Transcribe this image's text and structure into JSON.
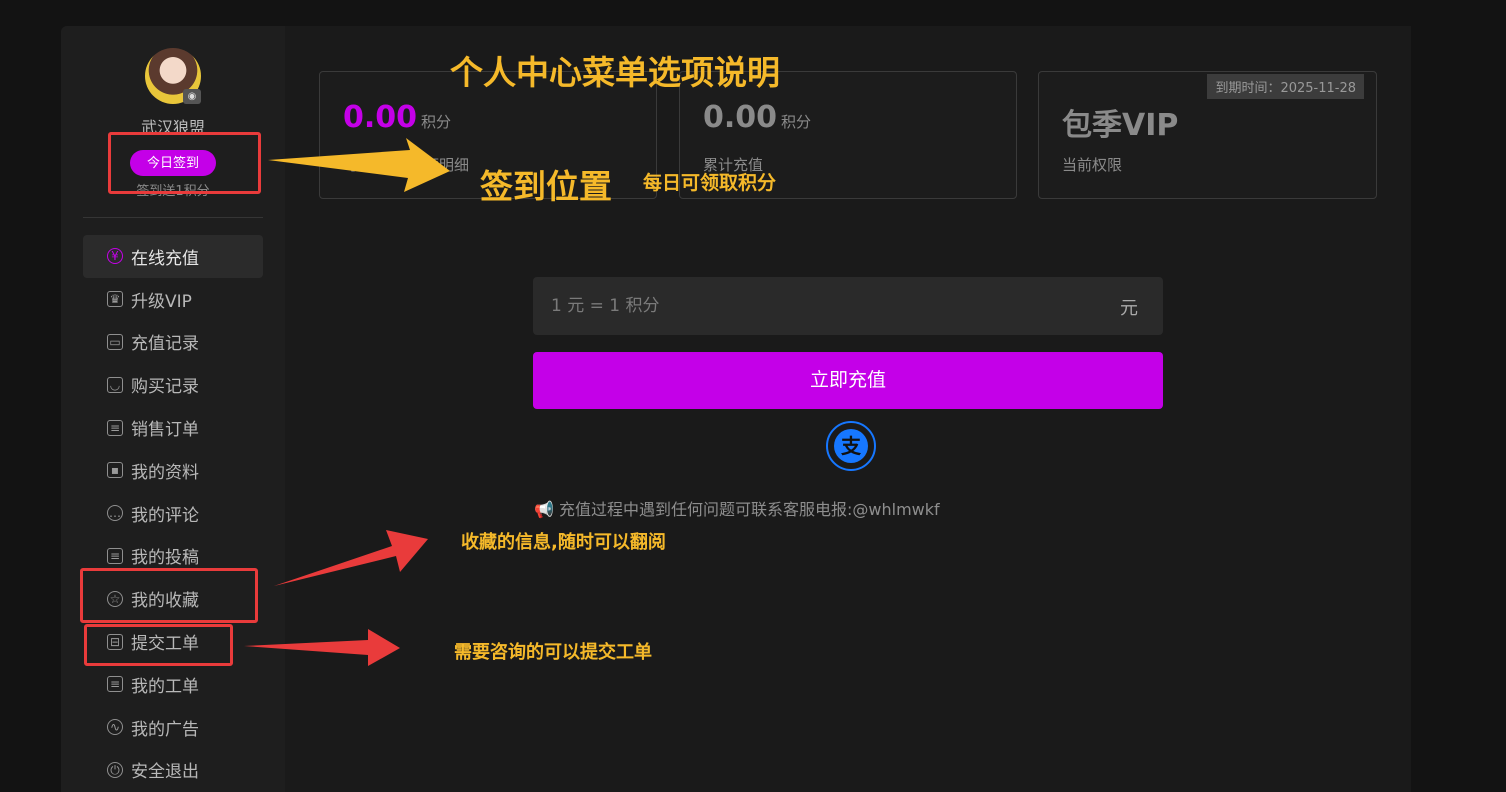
{
  "user": {
    "name": "武汉狼盟",
    "sign_button": "今日签到",
    "sign_hint": "签到送1积分"
  },
  "sidebar": {
    "items": [
      {
        "label": "在线充值",
        "icon": "yen-circle-icon",
        "active": true
      },
      {
        "label": "升级VIP",
        "icon": "crown-icon"
      },
      {
        "label": "充值记录",
        "icon": "wallet-icon"
      },
      {
        "label": "购买记录",
        "icon": "shopping-bag-icon"
      },
      {
        "label": "销售订单",
        "icon": "clipboard-icon"
      },
      {
        "label": "我的资料",
        "icon": "id-card-icon"
      },
      {
        "label": "我的评论",
        "icon": "comment-icon"
      },
      {
        "label": "我的投稿",
        "icon": "document-icon"
      },
      {
        "label": "我的收藏",
        "icon": "star-circle-icon"
      },
      {
        "label": "提交工单",
        "icon": "ticket-icon"
      },
      {
        "label": "我的工单",
        "icon": "list-icon"
      },
      {
        "label": "我的广告",
        "icon": "chart-icon"
      },
      {
        "label": "安全退出",
        "icon": "power-icon"
      }
    ]
  },
  "cards": [
    {
      "value": "0.00",
      "unit": "积分",
      "label": "可用余额",
      "link": "余额明细"
    },
    {
      "value": "0.00",
      "unit": "积分",
      "label": "累计充值"
    },
    {
      "value": "包季VIP",
      "label": "当前权限",
      "expire": "到期时间：2025-11-28"
    }
  ],
  "recharge": {
    "placeholder": "1 元 = 1 积分",
    "unit": "元",
    "button": "立即充值",
    "payment_icon": "alipay-icon",
    "notice": "充值过程中遇到任何问题可联系客服电报:@whlmwkf"
  },
  "annotations": {
    "title": "个人中心菜单选项说明",
    "sign_location": "签到位置",
    "sign_daily": "每日可领取积分",
    "favorites": "收藏的信息,随时可以翻阅",
    "ticket": "需要咨询的可以提交工单"
  },
  "colors": {
    "accent": "#c400e8",
    "annotation": "#f5b92a",
    "highlight": "#e93b3b",
    "alipay": "#1677ff"
  }
}
